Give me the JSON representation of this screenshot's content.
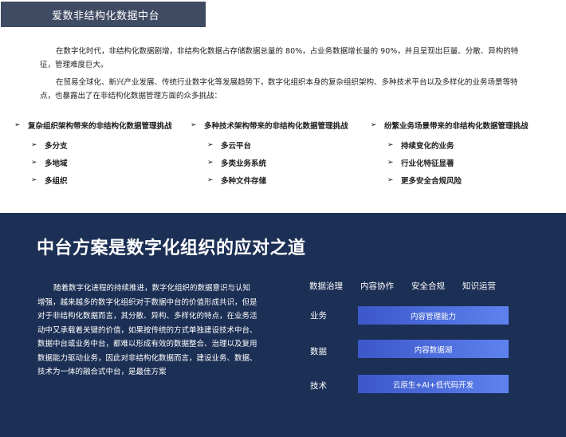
{
  "header": {
    "title": "爱数非结构化数据中台"
  },
  "intro": {
    "p1": "在数字化时代，非结构化数据剧增，非结构化数据占存储数据总量的 80%，占业务数据增长量的 90%，并且呈现出巨量、分散、异构的特征，管理难度巨大。",
    "p2": "在贸易全球化、新兴产业发展、传统行业数字化等发展趋势下，数字化组织本身的复杂组织架构、多种技术平台以及多样化的业务场景等特点，也暴露出了在非结构化数据管理方面的众多挑战："
  },
  "challenges": [
    {
      "title": "复杂组织架构带来的非结构化数据管理挑战",
      "items": [
        "多分支",
        "多地域",
        "多组织"
      ]
    },
    {
      "title": "多种技术架构带来的非结构化数据管理挑战",
      "items": [
        "多云平台",
        "多类业务系统",
        "多种文件存储"
      ]
    },
    {
      "title": "纷繁业务场景带来的非结构化数据管理挑战",
      "items": [
        "持续变化的业务",
        "行业化特征显著",
        "更多安全合规风险"
      ]
    }
  ],
  "panel": {
    "title": "中台方案是数字化组织的应对之道",
    "text": "随着数字化进程的持续推进，数字化组织的数据意识与认知增强，越来越多的数字化组织对于数据中台的价值形成共识，但是对于非结构化数据而言，其分散、异构、多样化的特点，在业务活动中又承载着关键的价值，如果按传统的方式单独建设技术中台、数据中台或业务中台，都难以形成有效的数据整合、治理以及复用数据能力驱动业务，因此对非结构化数据而言，建设业务、数据、技术为一体的融合式中台，是最佳方案",
    "capabilities": [
      "数据治理",
      "内容协作",
      "安全合规",
      "知识运营"
    ],
    "layers": [
      {
        "label": "业务",
        "bar": "内容管理能力"
      },
      {
        "label": "数据",
        "bar": "内容数据湖"
      },
      {
        "label": "技术",
        "bar": "云原生+AI+低代码开发"
      }
    ]
  },
  "colors": {
    "header_bg": "#3f4a63",
    "panel_bg": "#1c2f55",
    "bar_start": "#3c57c8",
    "bar_end": "#5d82ee"
  },
  "icons": {
    "bullet": "arrow-right-icon"
  }
}
